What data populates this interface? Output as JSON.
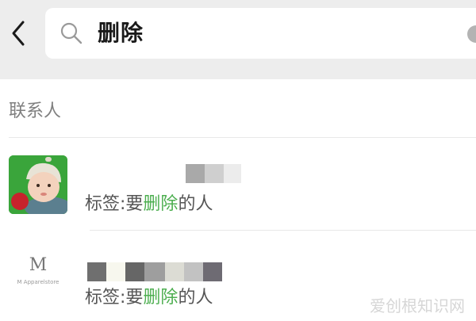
{
  "search": {
    "query": "删除"
  },
  "sections": {
    "contacts_label": "联系人"
  },
  "results": [
    {
      "tag_prefix": "标签:要",
      "tag_highlight": "删除",
      "tag_suffix": "的人"
    },
    {
      "avatar_text": "M",
      "avatar_subtext": "M Apparelstore",
      "tag_prefix": "标签:要",
      "tag_highlight": "删除",
      "tag_suffix": "的人"
    }
  ],
  "watermark": "爱创根知识网",
  "colors": {
    "highlight": "#4cae4f",
    "topbar_bg": "#ededed",
    "avatar_green": "#3aa53b"
  },
  "icons": {
    "back": "chevron-left-icon",
    "search": "search-icon",
    "clear": "clear-icon"
  }
}
